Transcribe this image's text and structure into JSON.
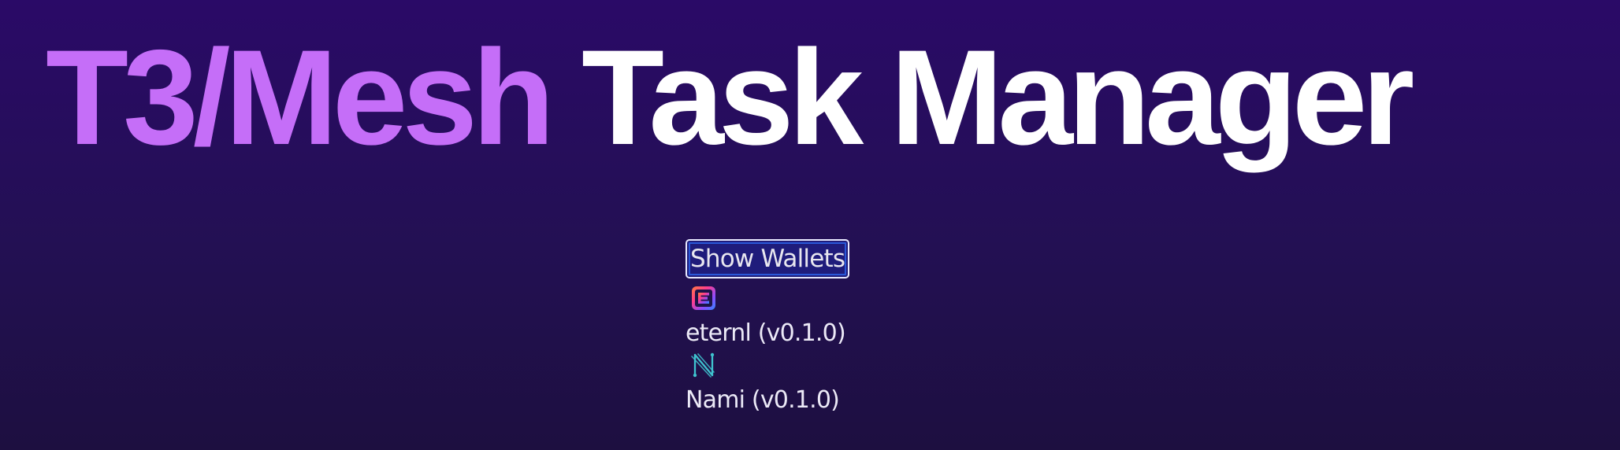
{
  "header": {
    "title_accent": "T3/Mesh",
    "title_rest": "Task Manager"
  },
  "wallets": {
    "toggle_label": "Show Wallets",
    "items": [
      {
        "icon": "eternl-icon",
        "label": "eternl (v0.1.0)"
      },
      {
        "icon": "nami-icon",
        "label": "Nami (v0.1.0)"
      }
    ]
  },
  "colors": {
    "background": "#2a0a67",
    "accent": "#c56ef8",
    "title_white": "#ffffff",
    "button_bg": "#1f1c7b",
    "button_focus": "#2a57d8"
  }
}
